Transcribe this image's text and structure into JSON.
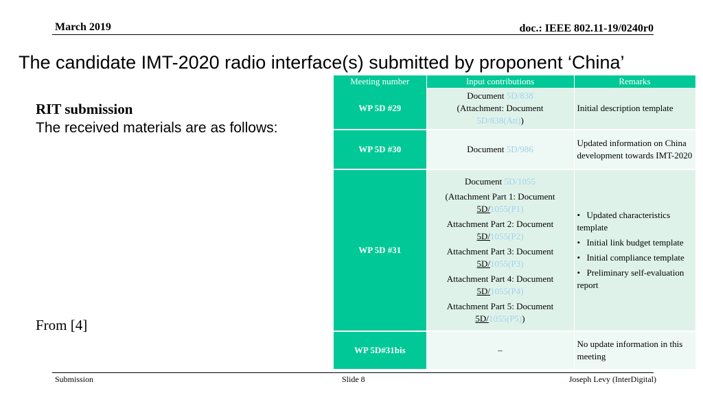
{
  "header": {
    "date": "March 2019",
    "doc": "doc.: IEEE 802.11-19/0240r0"
  },
  "title": "The candidate IMT-2020 radio interface(s) submitted by proponent ‘China’",
  "left": {
    "heading": "RIT submission",
    "body": "The received materials are as follows:",
    "source": "From [4]"
  },
  "table": {
    "headers": [
      "Meeting number",
      "Input contributions",
      "Remarks"
    ],
    "rows": [
      {
        "meeting": "WP 5D #29",
        "input": {
          "prefix": "Document ",
          "link": "5D/838",
          "att_open": "(Attachment: Document ",
          "att_link": "5D/838(Att)",
          "att_close": ")"
        },
        "remarks": "Initial description template"
      },
      {
        "meeting": "WP 5D #30",
        "input": {
          "prefix": "Document ",
          "link": "5D/986"
        },
        "remarks": "Updated information on China development towards IMT-2020"
      },
      {
        "meeting": "WP 5D #31",
        "input": {
          "prefix": "Document ",
          "link": "5D/1055",
          "parts": [
            {
              "label": "(Attachment Part 1: Document",
              "pre": "5D/",
              "link": "1055(P1)",
              "close": ""
            },
            {
              "label": "Attachment Part 2: Document",
              "pre": "5D/",
              "link": "1055(P2)",
              "close": ""
            },
            {
              "label": "Attachment Part 3: Document",
              "pre": "5D/",
              "link": "1055(P3)",
              "close": ""
            },
            {
              "label": "Attachment Part 4: Document",
              "pre": "5D/",
              "link": "1055(P4)",
              "close": ""
            },
            {
              "label": "Attachment Part 5: Document",
              "pre": "5D/",
              "link": "1055(P5)",
              "close": ")"
            }
          ]
        },
        "remarks_list": [
          "Updated characteristics template",
          "Initial link budget template",
          "Initial compliance template",
          "Preliminary self-evaluation report"
        ]
      },
      {
        "meeting": "WP 5D#31bis",
        "input": {
          "text": "–"
        },
        "remarks": "No update information in this meeting"
      }
    ]
  },
  "footer": {
    "left": "Submission",
    "center": "Slide 8",
    "right": "Joseph Levy (InterDigital)"
  },
  "colors": {
    "header_green": "#00c896",
    "cell_light": "#dff2ea",
    "cell_lighter": "#eef8f4",
    "link": "#9fd3ea"
  }
}
